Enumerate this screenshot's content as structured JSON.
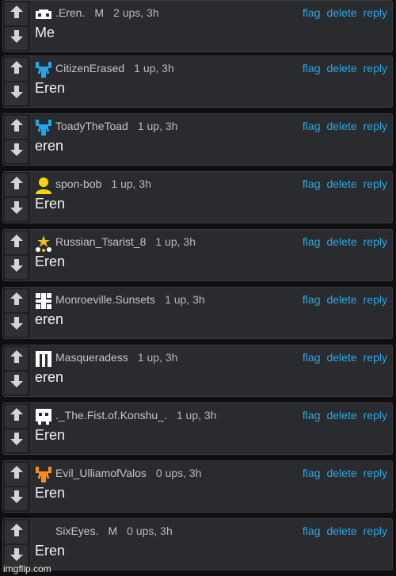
{
  "actions": {
    "flag": "flag",
    "delete": "delete",
    "reply": "reply"
  },
  "comments": [
    {
      "user": ".Eren.",
      "mod": "M",
      "points": "2 ups, 3h",
      "text": "Me",
      "avatar": "mask-icon",
      "color": "#ffffff"
    },
    {
      "user": "CitizenErased",
      "mod": "",
      "points": "1 up, 3h",
      "text": "Eren",
      "avatar": "pixel-critter-icon",
      "color": "#1ea6ef"
    },
    {
      "user": "ToadyTheToad",
      "mod": "",
      "points": "1 up, 3h",
      "text": "eren",
      "avatar": "pixel-critter-icon",
      "color": "#1ea6ef"
    },
    {
      "user": "spon-bob",
      "mod": "",
      "points": "1 up, 3h",
      "text": "Eren",
      "avatar": "person-icon",
      "color": "#ffd400"
    },
    {
      "user": "Russian_Tsarist_8",
      "mod": "",
      "points": "1 up, 3h",
      "text": "Eren",
      "avatar": "stars-icon",
      "color": "#f0c020"
    },
    {
      "user": "Monroeville.Sunsets",
      "mod": "",
      "points": "1 up, 3h",
      "text": "eren",
      "avatar": "pixel-grid-icon",
      "color": "#ffffff"
    },
    {
      "user": "Masqueradess",
      "mod": "",
      "points": "1 up, 3h",
      "text": "eren",
      "avatar": "pixel-bars-icon",
      "color": "#ffffff"
    },
    {
      "user": "._The.Fist.of.Konshu_.",
      "mod": "",
      "points": "1 up, 3h",
      "text": "Eren",
      "avatar": "pixel-face-icon",
      "color": "#ffffff"
    },
    {
      "user": "Evil_UlliamofValos",
      "mod": "",
      "points": "0 ups, 3h",
      "text": "Eren",
      "avatar": "pixel-critter-icon",
      "color": "#ff8a1e"
    },
    {
      "user": "SixEyes.",
      "mod": "M",
      "points": "0 ups, 3h",
      "text": "Eren",
      "avatar": "",
      "color": ""
    }
  ],
  "watermark": "imgflip.com"
}
